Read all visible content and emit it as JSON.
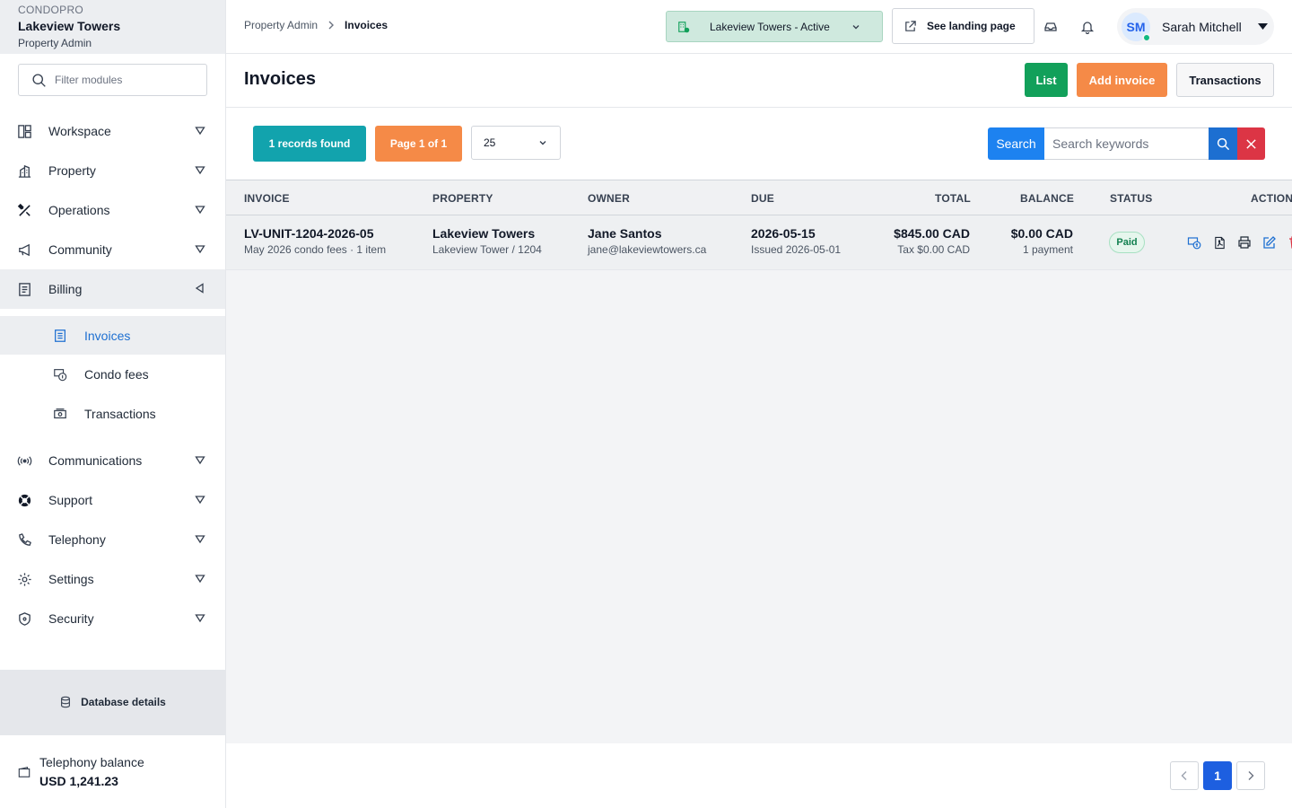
{
  "brand": {
    "app": "CONDOPRO",
    "property": "Lakeview Towers",
    "role": "Property Admin"
  },
  "sidebar": {
    "filter_placeholder": "Filter modules",
    "items": [
      {
        "label": "Workspace",
        "icon": "workspace-icon"
      },
      {
        "label": "Property",
        "icon": "building-icon"
      },
      {
        "label": "Operations",
        "icon": "tools-icon"
      },
      {
        "label": "Community",
        "icon": "megaphone-icon"
      },
      {
        "label": "Billing",
        "icon": "receipt-icon"
      },
      {
        "label": "Communications",
        "icon": "broadcast-icon"
      },
      {
        "label": "Support",
        "icon": "lifebuoy-icon"
      },
      {
        "label": "Telephony",
        "icon": "phone-icon"
      },
      {
        "label": "Settings",
        "icon": "gear-icon"
      },
      {
        "label": "Security",
        "icon": "shield-icon"
      }
    ],
    "billing_sub": [
      {
        "label": "Invoices",
        "icon": "invoice-icon"
      },
      {
        "label": "Condo fees",
        "icon": "fee-icon"
      },
      {
        "label": "Transactions",
        "icon": "cash-icon"
      }
    ],
    "db_details": "Database details",
    "telephony_balance": {
      "label": "Telephony balance",
      "value": "USD 1,241.23"
    }
  },
  "topbar": {
    "breadcrumb": [
      "Property Admin",
      "Invoices"
    ],
    "property_select": "Lakeview Towers - Active",
    "landing_button": "See landing page",
    "user": {
      "initials": "SM",
      "name": "Sarah Mitchell"
    }
  },
  "page": {
    "title": "Invoices",
    "buttons": {
      "list": "List",
      "add": "Add invoice",
      "transactions": "Transactions"
    }
  },
  "toolbar": {
    "records": "1 records found",
    "page_info": "Page 1 of 1",
    "per_page": "25",
    "search_label": "Search",
    "search_placeholder": "Search keywords"
  },
  "table": {
    "columns": [
      "INVOICE",
      "PROPERTY",
      "OWNER",
      "DUE",
      "TOTAL",
      "BALANCE",
      "STATUS",
      "ACTIONS"
    ],
    "rows": [
      {
        "invoice": "LV-UNIT-1204-2026-05",
        "invoice_sub": "May 2026 condo fees · 1 item",
        "property": "Lakeview Towers",
        "property_sub": "Lakeview Tower / 1204",
        "owner": "Jane Santos",
        "owner_email": "jane@lakeviewtowers.ca",
        "due": "2026-05-15",
        "issued": "Issued 2026-05-01",
        "total": "$845.00 CAD",
        "tax": "Tax $0.00 CAD",
        "balance": "$0.00 CAD",
        "payments": "1 payment",
        "status": "Paid"
      }
    ]
  },
  "pagination": {
    "current": "1"
  },
  "colors": {
    "primary": "#1d82f0",
    "success": "#12a05a",
    "accent": "#f58a47",
    "teal": "#12a3ad",
    "danger": "#dc3545"
  }
}
